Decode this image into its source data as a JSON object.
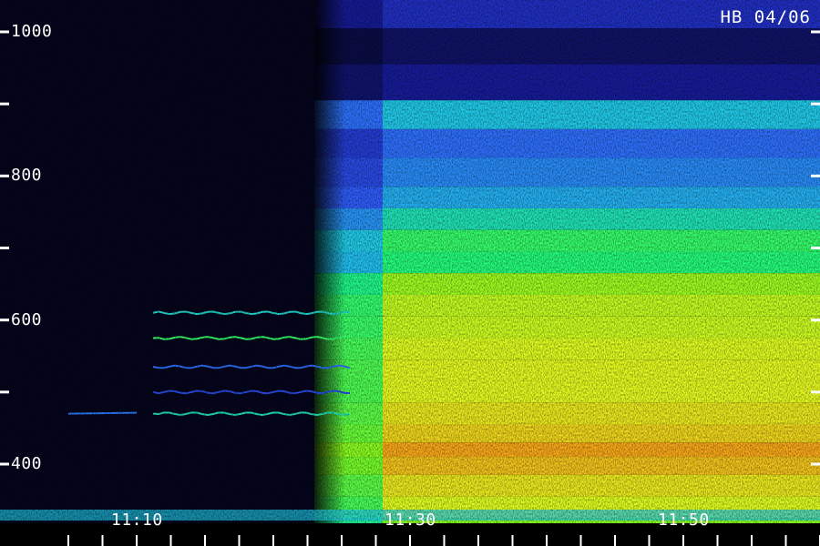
{
  "chart_data": {
    "type": "heatmap",
    "title": "",
    "corner_label": "HB 04/06",
    "xlabel": "",
    "ylabel": "",
    "x_axis": {
      "range": [
        "11:05",
        "11:55"
      ],
      "tick_labels": [
        {
          "text": "11:10",
          "value": "11:10"
        },
        {
          "text": "11:30",
          "value": "11:30"
        },
        {
          "text": "11:50",
          "value": "11:50"
        }
      ],
      "minor_tick_step_min": 2.5
    },
    "y_axis": {
      "range": [
        300,
        1050
      ],
      "tick_labels": [
        {
          "text": "1000",
          "value": 1000
        },
        {
          "text": "800",
          "value": 800
        },
        {
          "text": "600",
          "value": 600
        },
        {
          "text": "400",
          "value": 400
        }
      ],
      "unlabeled_ticks": [
        900,
        700,
        500
      ]
    },
    "colorscale": [
      "#000000",
      "#0a0c40",
      "#1a20b0",
      "#3060ff",
      "#20c8f0",
      "#20ff80",
      "#80ff20",
      "#e8ff20",
      "#ff9a18",
      "#ff3010"
    ],
    "onset_time": "11:23",
    "full_signal_time": "11:28",
    "narrowband_lines_hz": [
      610,
      575,
      535,
      500,
      470
    ],
    "broadband_levels": [
      {
        "freq_hz": 1030,
        "level": 0.25
      },
      {
        "freq_hz": 980,
        "level": 0.15
      },
      {
        "freq_hz": 930,
        "level": 0.2
      },
      {
        "freq_hz": 880,
        "level": 0.45
      },
      {
        "freq_hz": 850,
        "level": 0.35
      },
      {
        "freq_hz": 800,
        "level": 0.38
      },
      {
        "freq_hz": 770,
        "level": 0.42
      },
      {
        "freq_hz": 740,
        "level": 0.5
      },
      {
        "freq_hz": 710,
        "level": 0.58
      },
      {
        "freq_hz": 680,
        "level": 0.56
      },
      {
        "freq_hz": 650,
        "level": 0.7
      },
      {
        "freq_hz": 620,
        "level": 0.74
      },
      {
        "freq_hz": 590,
        "level": 0.75
      },
      {
        "freq_hz": 560,
        "level": 0.77
      },
      {
        "freq_hz": 530,
        "level": 0.78
      },
      {
        "freq_hz": 500,
        "level": 0.78
      },
      {
        "freq_hz": 470,
        "level": 0.8
      },
      {
        "freq_hz": 440,
        "level": 0.82
      },
      {
        "freq_hz": 420,
        "level": 0.87
      },
      {
        "freq_hz": 400,
        "level": 0.84
      },
      {
        "freq_hz": 370,
        "level": 0.8
      },
      {
        "freq_hz": 340,
        "level": 0.77
      },
      {
        "freq_hz": 310,
        "level": 0.68
      }
    ]
  }
}
